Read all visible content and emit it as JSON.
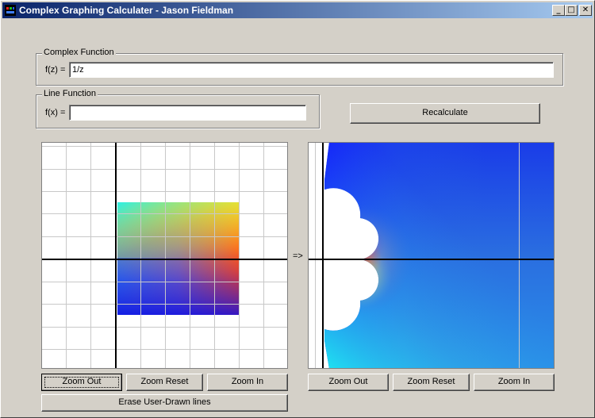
{
  "window": {
    "title": "Complex Graphing Calculater - Jason Fieldman",
    "minimize_glyph": "_",
    "maximize_glyph": "□",
    "close_glyph": "✕"
  },
  "complex_function": {
    "group_label": "Complex Function",
    "field_label": "f(z) =",
    "value": "1/z"
  },
  "line_function": {
    "group_label": "Line Function",
    "field_label": "f(x) =",
    "value": ""
  },
  "recalculate_label": "Recalculate",
  "mapping_arrow": "=>",
  "left_graph": {
    "zoom_out_label": "Zoom Out",
    "zoom_reset_label": "Zoom Reset",
    "zoom_in_label": "Zoom In",
    "erase_label": "Erase User-Drawn lines"
  },
  "right_graph": {
    "zoom_out_label": "Zoom Out",
    "zoom_reset_label": "Zoom Reset",
    "zoom_in_label": "Zoom In"
  },
  "colors": {
    "title_gradient_start": "#0a246a",
    "title_gradient_end": "#a6caf0",
    "face": "#d4d0c8",
    "grid": "#c8c8c8",
    "axis": "#000000"
  }
}
